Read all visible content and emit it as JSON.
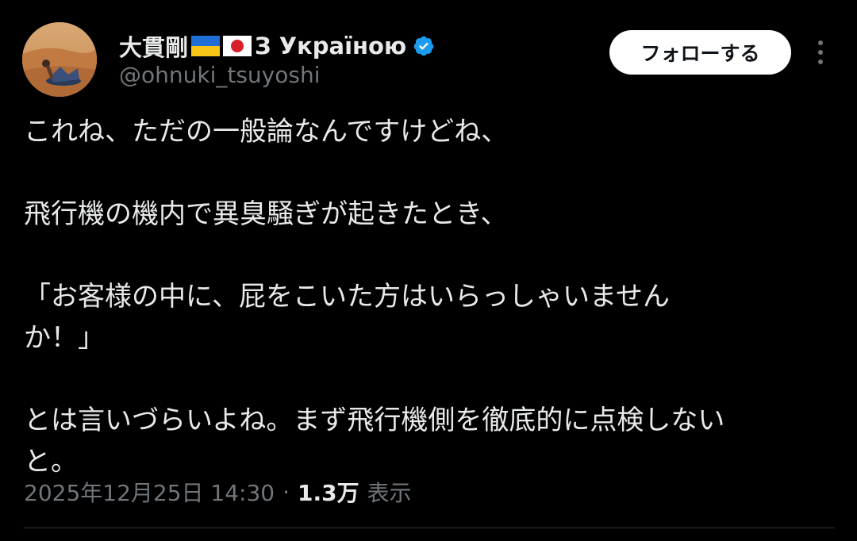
{
  "author": {
    "display_name_prefix": "大貫剛",
    "display_name_suffix": "З Україною",
    "handle": "@ohnuki_tsuyoshi",
    "verified": true,
    "flags": [
      "ukraine-flag-icon",
      "japan-flag-icon"
    ]
  },
  "actions": {
    "follow_label": "フォローする",
    "more_icon": "more-icon"
  },
  "tweet": {
    "text": "これね、ただの一般論なんですけどね、\n\n飛行機の機内で異臭騒ぎが起きたとき、\n\n「お客様の中に、屁をこいた方はいらっしゃいません\nか！」\n\nとは言いづらいよね。まず飛行機側を徹底的に点検しない\nと。"
  },
  "meta": {
    "timestamp": "2025年12月25日 14:30",
    "separator": "·",
    "views_count": "1.3万",
    "views_label": "表示"
  },
  "colors": {
    "background": "#000000",
    "text_primary": "#e7e9ea",
    "text_secondary": "#71767b",
    "verified_blue": "#1d9bf0",
    "follow_bg": "#ffffff",
    "divider": "#2f3336"
  }
}
